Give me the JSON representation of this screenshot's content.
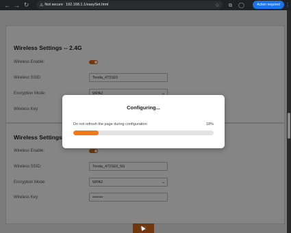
{
  "browser": {
    "back_icon": "arrow-left-icon",
    "forward_icon": "arrow-right-icon",
    "reload_icon": "reload-icon",
    "security_label": "Not secure",
    "url": "192.168.1.1/easySet.html",
    "action_label": "Action required"
  },
  "page": {
    "section1": {
      "title": "Wireless Settings -- 2.4G",
      "enable_label": "Wireless Enable:",
      "ssid_label": "Wireless SSID:",
      "ssid_value": "Tenda_4721E0",
      "encryption_label": "Encryption Mode:",
      "encryption_value": "WPA2",
      "key_label": "Wireless Key:"
    },
    "section2": {
      "title": "Wireless Settings -",
      "enable_label": "Wireless Enable:",
      "ssid_label": "Wireless SSID:",
      "ssid_value": "Tenda_4721E0_5G",
      "encryption_label": "Encryption Mode:",
      "encryption_value": "WPA2",
      "key_label": "Wireless Key:",
      "key_value": "••••••••"
    },
    "save_label": "OK"
  },
  "modal": {
    "title": "Configuring...",
    "message": "Do not refresh the page during configuration",
    "percent_label": "18%",
    "progress": 0.18
  },
  "colors": {
    "accent": "#f07a1a",
    "toggle_on": "#d86a1e",
    "action_button": "#1a73e8"
  }
}
